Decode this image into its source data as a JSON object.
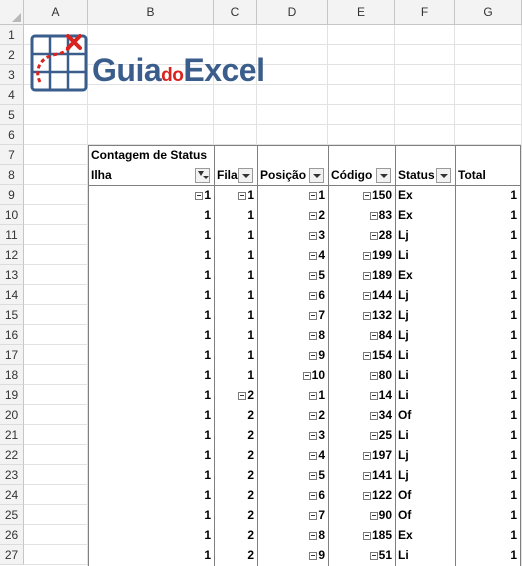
{
  "columns": [
    "A",
    "B",
    "C",
    "D",
    "E",
    "F",
    "G"
  ],
  "rows": [
    "1",
    "2",
    "3",
    "4",
    "5",
    "6",
    "7",
    "8",
    "9",
    "10",
    "11",
    "12",
    "13",
    "14",
    "15",
    "16",
    "17",
    "18",
    "19",
    "20",
    "21",
    "22",
    "23",
    "24",
    "25",
    "26",
    "27"
  ],
  "logo": {
    "text_guia": "Guia",
    "text_do": "do",
    "text_excel": "Excel"
  },
  "pivot": {
    "title": "Contagem de Status",
    "headers": {
      "ilha": "Ilha",
      "fila": "Fila",
      "posicao": "Posição",
      "codigo": "Código",
      "status": "Status",
      "total": "Total"
    },
    "rows": [
      {
        "ilha": "1",
        "fila": "1",
        "posicao": "1",
        "codigo": "150",
        "status": "Ex",
        "total": "1"
      },
      {
        "ilha": "1",
        "fila": "1",
        "posicao": "2",
        "codigo": "83",
        "status": "Ex",
        "total": "1"
      },
      {
        "ilha": "1",
        "fila": "1",
        "posicao": "3",
        "codigo": "28",
        "status": "Lj",
        "total": "1"
      },
      {
        "ilha": "1",
        "fila": "1",
        "posicao": "4",
        "codigo": "199",
        "status": "Li",
        "total": "1"
      },
      {
        "ilha": "1",
        "fila": "1",
        "posicao": "5",
        "codigo": "189",
        "status": "Ex",
        "total": "1"
      },
      {
        "ilha": "1",
        "fila": "1",
        "posicao": "6",
        "codigo": "144",
        "status": "Lj",
        "total": "1"
      },
      {
        "ilha": "1",
        "fila": "1",
        "posicao": "7",
        "codigo": "132",
        "status": "Lj",
        "total": "1"
      },
      {
        "ilha": "1",
        "fila": "1",
        "posicao": "8",
        "codigo": "84",
        "status": "Lj",
        "total": "1"
      },
      {
        "ilha": "1",
        "fila": "1",
        "posicao": "9",
        "codigo": "154",
        "status": "Li",
        "total": "1"
      },
      {
        "ilha": "1",
        "fila": "1",
        "posicao": "10",
        "codigo": "80",
        "status": "Li",
        "total": "1"
      },
      {
        "ilha": "1",
        "fila": "2",
        "posicao": "1",
        "codigo": "14",
        "status": "Li",
        "total": "1"
      },
      {
        "ilha": "1",
        "fila": "2",
        "posicao": "2",
        "codigo": "34",
        "status": "Of",
        "total": "1"
      },
      {
        "ilha": "1",
        "fila": "2",
        "posicao": "3",
        "codigo": "25",
        "status": "Li",
        "total": "1"
      },
      {
        "ilha": "1",
        "fila": "2",
        "posicao": "4",
        "codigo": "197",
        "status": "Lj",
        "total": "1"
      },
      {
        "ilha": "1",
        "fila": "2",
        "posicao": "5",
        "codigo": "141",
        "status": "Lj",
        "total": "1"
      },
      {
        "ilha": "1",
        "fila": "2",
        "posicao": "6",
        "codigo": "122",
        "status": "Of",
        "total": "1"
      },
      {
        "ilha": "1",
        "fila": "2",
        "posicao": "7",
        "codigo": "90",
        "status": "Of",
        "total": "1"
      },
      {
        "ilha": "1",
        "fila": "2",
        "posicao": "8",
        "codigo": "185",
        "status": "Ex",
        "total": "1"
      },
      {
        "ilha": "1",
        "fila": "2",
        "posicao": "9",
        "codigo": "51",
        "status": "Li",
        "total": "1"
      }
    ],
    "expand_markers": {
      "ilha": [
        0
      ],
      "fila": [
        0,
        10
      ],
      "posicao": "all",
      "codigo": "all"
    }
  },
  "colors": {
    "brand_blue": "#3a5d8c",
    "brand_red": "#d8231f"
  }
}
